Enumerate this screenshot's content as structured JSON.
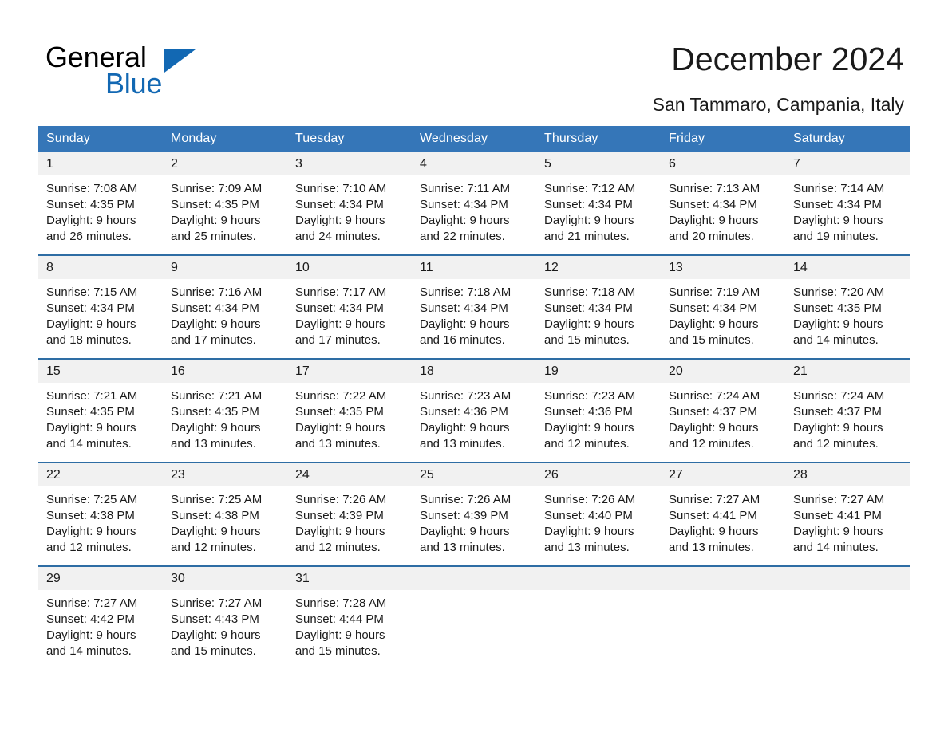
{
  "brand": {
    "name_part1": "General",
    "name_part2": "Blue",
    "triangle_icon": "triangle-icon",
    "accent_color": "#1268b3"
  },
  "header": {
    "title": "December 2024",
    "location": "San Tammaro, Campania, Italy"
  },
  "calendar": {
    "header_bg": "#3576b8",
    "row_divider": "#2e6da4",
    "daynum_bg": "#f1f1f1",
    "weekdays": [
      "Sunday",
      "Monday",
      "Tuesday",
      "Wednesday",
      "Thursday",
      "Friday",
      "Saturday"
    ],
    "weeks": [
      [
        {
          "day": "1",
          "sunrise": "Sunrise: 7:08 AM",
          "sunset": "Sunset: 4:35 PM",
          "daylight1": "Daylight: 9 hours",
          "daylight2": "and 26 minutes."
        },
        {
          "day": "2",
          "sunrise": "Sunrise: 7:09 AM",
          "sunset": "Sunset: 4:35 PM",
          "daylight1": "Daylight: 9 hours",
          "daylight2": "and 25 minutes."
        },
        {
          "day": "3",
          "sunrise": "Sunrise: 7:10 AM",
          "sunset": "Sunset: 4:34 PM",
          "daylight1": "Daylight: 9 hours",
          "daylight2": "and 24 minutes."
        },
        {
          "day": "4",
          "sunrise": "Sunrise: 7:11 AM",
          "sunset": "Sunset: 4:34 PM",
          "daylight1": "Daylight: 9 hours",
          "daylight2": "and 22 minutes."
        },
        {
          "day": "5",
          "sunrise": "Sunrise: 7:12 AM",
          "sunset": "Sunset: 4:34 PM",
          "daylight1": "Daylight: 9 hours",
          "daylight2": "and 21 minutes."
        },
        {
          "day": "6",
          "sunrise": "Sunrise: 7:13 AM",
          "sunset": "Sunset: 4:34 PM",
          "daylight1": "Daylight: 9 hours",
          "daylight2": "and 20 minutes."
        },
        {
          "day": "7",
          "sunrise": "Sunrise: 7:14 AM",
          "sunset": "Sunset: 4:34 PM",
          "daylight1": "Daylight: 9 hours",
          "daylight2": "and 19 minutes."
        }
      ],
      [
        {
          "day": "8",
          "sunrise": "Sunrise: 7:15 AM",
          "sunset": "Sunset: 4:34 PM",
          "daylight1": "Daylight: 9 hours",
          "daylight2": "and 18 minutes."
        },
        {
          "day": "9",
          "sunrise": "Sunrise: 7:16 AM",
          "sunset": "Sunset: 4:34 PM",
          "daylight1": "Daylight: 9 hours",
          "daylight2": "and 17 minutes."
        },
        {
          "day": "10",
          "sunrise": "Sunrise: 7:17 AM",
          "sunset": "Sunset: 4:34 PM",
          "daylight1": "Daylight: 9 hours",
          "daylight2": "and 17 minutes."
        },
        {
          "day": "11",
          "sunrise": "Sunrise: 7:18 AM",
          "sunset": "Sunset: 4:34 PM",
          "daylight1": "Daylight: 9 hours",
          "daylight2": "and 16 minutes."
        },
        {
          "day": "12",
          "sunrise": "Sunrise: 7:18 AM",
          "sunset": "Sunset: 4:34 PM",
          "daylight1": "Daylight: 9 hours",
          "daylight2": "and 15 minutes."
        },
        {
          "day": "13",
          "sunrise": "Sunrise: 7:19 AM",
          "sunset": "Sunset: 4:34 PM",
          "daylight1": "Daylight: 9 hours",
          "daylight2": "and 15 minutes."
        },
        {
          "day": "14",
          "sunrise": "Sunrise: 7:20 AM",
          "sunset": "Sunset: 4:35 PM",
          "daylight1": "Daylight: 9 hours",
          "daylight2": "and 14 minutes."
        }
      ],
      [
        {
          "day": "15",
          "sunrise": "Sunrise: 7:21 AM",
          "sunset": "Sunset: 4:35 PM",
          "daylight1": "Daylight: 9 hours",
          "daylight2": "and 14 minutes."
        },
        {
          "day": "16",
          "sunrise": "Sunrise: 7:21 AM",
          "sunset": "Sunset: 4:35 PM",
          "daylight1": "Daylight: 9 hours",
          "daylight2": "and 13 minutes."
        },
        {
          "day": "17",
          "sunrise": "Sunrise: 7:22 AM",
          "sunset": "Sunset: 4:35 PM",
          "daylight1": "Daylight: 9 hours",
          "daylight2": "and 13 minutes."
        },
        {
          "day": "18",
          "sunrise": "Sunrise: 7:23 AM",
          "sunset": "Sunset: 4:36 PM",
          "daylight1": "Daylight: 9 hours",
          "daylight2": "and 13 minutes."
        },
        {
          "day": "19",
          "sunrise": "Sunrise: 7:23 AM",
          "sunset": "Sunset: 4:36 PM",
          "daylight1": "Daylight: 9 hours",
          "daylight2": "and 12 minutes."
        },
        {
          "day": "20",
          "sunrise": "Sunrise: 7:24 AM",
          "sunset": "Sunset: 4:37 PM",
          "daylight1": "Daylight: 9 hours",
          "daylight2": "and 12 minutes."
        },
        {
          "day": "21",
          "sunrise": "Sunrise: 7:24 AM",
          "sunset": "Sunset: 4:37 PM",
          "daylight1": "Daylight: 9 hours",
          "daylight2": "and 12 minutes."
        }
      ],
      [
        {
          "day": "22",
          "sunrise": "Sunrise: 7:25 AM",
          "sunset": "Sunset: 4:38 PM",
          "daylight1": "Daylight: 9 hours",
          "daylight2": "and 12 minutes."
        },
        {
          "day": "23",
          "sunrise": "Sunrise: 7:25 AM",
          "sunset": "Sunset: 4:38 PM",
          "daylight1": "Daylight: 9 hours",
          "daylight2": "and 12 minutes."
        },
        {
          "day": "24",
          "sunrise": "Sunrise: 7:26 AM",
          "sunset": "Sunset: 4:39 PM",
          "daylight1": "Daylight: 9 hours",
          "daylight2": "and 12 minutes."
        },
        {
          "day": "25",
          "sunrise": "Sunrise: 7:26 AM",
          "sunset": "Sunset: 4:39 PM",
          "daylight1": "Daylight: 9 hours",
          "daylight2": "and 13 minutes."
        },
        {
          "day": "26",
          "sunrise": "Sunrise: 7:26 AM",
          "sunset": "Sunset: 4:40 PM",
          "daylight1": "Daylight: 9 hours",
          "daylight2": "and 13 minutes."
        },
        {
          "day": "27",
          "sunrise": "Sunrise: 7:27 AM",
          "sunset": "Sunset: 4:41 PM",
          "daylight1": "Daylight: 9 hours",
          "daylight2": "and 13 minutes."
        },
        {
          "day": "28",
          "sunrise": "Sunrise: 7:27 AM",
          "sunset": "Sunset: 4:41 PM",
          "daylight1": "Daylight: 9 hours",
          "daylight2": "and 14 minutes."
        }
      ],
      [
        {
          "day": "29",
          "sunrise": "Sunrise: 7:27 AM",
          "sunset": "Sunset: 4:42 PM",
          "daylight1": "Daylight: 9 hours",
          "daylight2": "and 14 minutes."
        },
        {
          "day": "30",
          "sunrise": "Sunrise: 7:27 AM",
          "sunset": "Sunset: 4:43 PM",
          "daylight1": "Daylight: 9 hours",
          "daylight2": "and 15 minutes."
        },
        {
          "day": "31",
          "sunrise": "Sunrise: 7:28 AM",
          "sunset": "Sunset: 4:44 PM",
          "daylight1": "Daylight: 9 hours",
          "daylight2": "and 15 minutes."
        },
        {
          "day": "",
          "sunrise": "",
          "sunset": "",
          "daylight1": "",
          "daylight2": ""
        },
        {
          "day": "",
          "sunrise": "",
          "sunset": "",
          "daylight1": "",
          "daylight2": ""
        },
        {
          "day": "",
          "sunrise": "",
          "sunset": "",
          "daylight1": "",
          "daylight2": ""
        },
        {
          "day": "",
          "sunrise": "",
          "sunset": "",
          "daylight1": "",
          "daylight2": ""
        }
      ]
    ]
  }
}
